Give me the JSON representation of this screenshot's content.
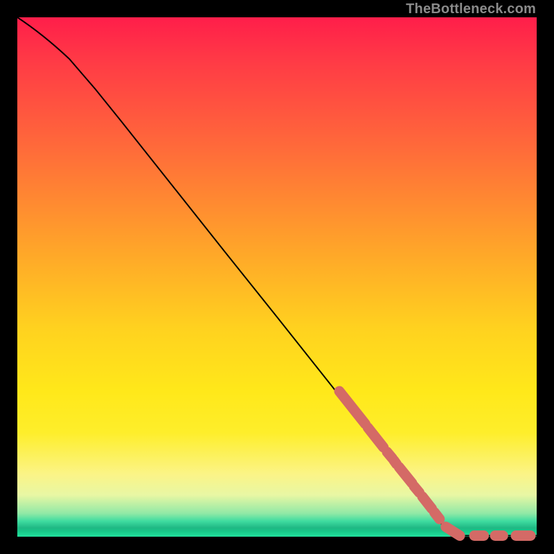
{
  "watermark": "TheBottleneck.com",
  "chart_data": {
    "type": "line",
    "title": "",
    "xlabel": "",
    "ylabel": "",
    "xlim": [
      0,
      100
    ],
    "ylim": [
      0,
      100
    ],
    "grid": false,
    "legend": false,
    "curve": [
      {
        "x": 0,
        "y": 100
      },
      {
        "x": 5,
        "y": 96.7
      },
      {
        "x": 10,
        "y": 92.0
      },
      {
        "x": 15,
        "y": 86.2
      },
      {
        "x": 20,
        "y": 80.0
      },
      {
        "x": 30,
        "y": 67.4
      },
      {
        "x": 40,
        "y": 54.8
      },
      {
        "x": 50,
        "y": 42.3
      },
      {
        "x": 60,
        "y": 29.7
      },
      {
        "x": 70,
        "y": 17.1
      },
      {
        "x": 80,
        "y": 4.5
      },
      {
        "x": 83.5,
        "y": 0.2
      },
      {
        "x": 90,
        "y": 0.2
      },
      {
        "x": 100,
        "y": 0.2
      }
    ],
    "highlight_segments": [
      {
        "x1": 62,
        "y1": 28.0,
        "x2": 67,
        "y2": 21.7
      },
      {
        "x1": 67.5,
        "y1": 21.0,
        "x2": 70.5,
        "y2": 17.2
      },
      {
        "x1": 71.2,
        "y1": 16.3,
        "x2": 72.2,
        "y2": 15.1
      },
      {
        "x1": 72.5,
        "y1": 14.7,
        "x2": 73.0,
        "y2": 14.0
      },
      {
        "x1": 73.5,
        "y1": 13.4,
        "x2": 76.0,
        "y2": 10.3
      },
      {
        "x1": 76.4,
        "y1": 9.7,
        "x2": 77.4,
        "y2": 8.5
      },
      {
        "x1": 78.0,
        "y1": 7.7,
        "x2": 79.8,
        "y2": 5.4
      },
      {
        "x1": 80.3,
        "y1": 4.7,
        "x2": 81.3,
        "y2": 3.4
      },
      {
        "x1": 82.5,
        "y1": 1.9,
        "x2": 85.2,
        "y2": 0.2
      },
      {
        "x1": 88.0,
        "y1": 0.2,
        "x2": 89.8,
        "y2": 0.2
      },
      {
        "x1": 92.0,
        "y1": 0.2,
        "x2": 93.5,
        "y2": 0.2
      },
      {
        "x1": 96.0,
        "y1": 0.2,
        "x2": 98.8,
        "y2": 0.2
      }
    ],
    "colors": {
      "line": "#000000",
      "highlight": "#d46a66",
      "gradient_top": "#ff1e4a",
      "gradient_mid": "#ffe81a",
      "gradient_bottom": "#22e29e"
    }
  }
}
